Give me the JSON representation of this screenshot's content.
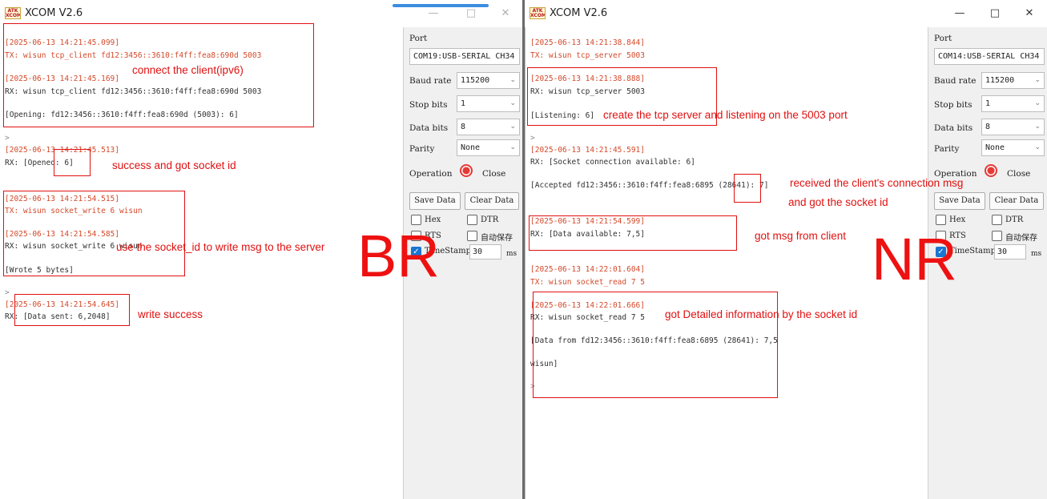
{
  "left_window": {
    "title": "XCOM V2.6",
    "logo_text": "ATK XCOM",
    "controls": {
      "minimize": "—",
      "maximize": "□",
      "close": "✕"
    },
    "terminal_lines": [
      {
        "text": "[2025-06-13 14:21:45.099]",
        "kind": "ts"
      },
      {
        "text": "TX: wisun tcp_client fd12:3456::3610:f4ff:fea8:690d 5003",
        "kind": "tx"
      },
      {
        "text": "[2025-06-13 14:21:45.169]",
        "kind": "ts"
      },
      {
        "text": "RX: wisun tcp_client fd12:3456::3610:f4ff:fea8:690d 5003",
        "kind": "rx"
      },
      {
        "text": "[Opening: fd12:3456::3610:f4ff:fea8:690d (5003): 6]",
        "kind": "rx"
      },
      {
        "text": ">",
        "kind": "gray"
      },
      {
        "text": "[2025-06-13 14:21:45.513]",
        "kind": "ts"
      },
      {
        "text": "RX: [Opened: 6]",
        "kind": "rx"
      },
      {
        "text": "[2025-06-13 14:21:54.515]",
        "kind": "ts"
      },
      {
        "text": "TX: wisun socket_write 6 wisun",
        "kind": "tx"
      },
      {
        "text": "[2025-06-13 14:21:54.585]",
        "kind": "ts"
      },
      {
        "text": "RX: wisun socket_write 6 wisun",
        "kind": "rx"
      },
      {
        "text": "[Wrote 5 bytes]",
        "kind": "rx"
      },
      {
        "text": ">",
        "kind": "gray"
      },
      {
        "text": "[2025-06-13 14:21:54.645]",
        "kind": "ts"
      },
      {
        "text": "RX: [Data sent: 6,2048]",
        "kind": "rx"
      }
    ],
    "annotations": {
      "connect": "connect the client(ipv6)",
      "success": "success and got socket id",
      "use_socket": "use the socket_id to write msg to the server",
      "write_success": "write success",
      "big_label": "BR"
    },
    "panel": {
      "port_label": "Port",
      "port_value": "COM19:USB-SERIAL CH34",
      "baud_label": "Baud rate",
      "baud_value": "115200",
      "stop_label": "Stop bits",
      "stop_value": "1",
      "data_label": "Data bits",
      "data_value": "8",
      "parity_label": "Parity",
      "parity_value": "None",
      "operation_label": "Operation",
      "close_label": "Close",
      "save_label": "Save Data",
      "clear_label": "Clear Data",
      "hex_label": "Hex",
      "dtr_label": "DTR",
      "rts_label": "RTS",
      "autosave_label": "自动保存",
      "timestamp_label": "TimeStamp",
      "timestamp_value": "30",
      "ms_label": "ms"
    }
  },
  "right_window": {
    "title": "XCOM V2.6",
    "logo_text": "ATK XCOM",
    "controls": {
      "minimize": "—",
      "maximize": "□",
      "close": "✕"
    },
    "terminal_lines": [
      {
        "text": "[2025-06-13 14:21:38.844]",
        "kind": "ts"
      },
      {
        "text": "TX: wisun tcp_server 5003",
        "kind": "tx"
      },
      {
        "text": "[2025-06-13 14:21:38.888]",
        "kind": "ts"
      },
      {
        "text": "RX: wisun tcp_server 5003",
        "kind": "rx"
      },
      {
        "text": "[Listening: 6]",
        "kind": "rx"
      },
      {
        "text": ">",
        "kind": "gray"
      },
      {
        "text": "[2025-06-13 14:21:45.591]",
        "kind": "ts"
      },
      {
        "text": "RX: [Socket connection available: 6]",
        "kind": "rx"
      },
      {
        "text": "[Accepted fd12:3456::3610:f4ff:fea8:6895 (28641): 7]",
        "kind": "rx"
      },
      {
        "text": "[2025-06-13 14:21:54.599]",
        "kind": "ts"
      },
      {
        "text": "RX: [Data available: 7,5]",
        "kind": "rx"
      },
      {
        "text": "[2025-06-13 14:22:01.604]",
        "kind": "ts"
      },
      {
        "text": "TX: wisun socket_read 7 5",
        "kind": "tx"
      },
      {
        "text": "[2025-06-13 14:22:01.666]",
        "kind": "ts"
      },
      {
        "text": "RX: wisun socket_read 7 5",
        "kind": "rx"
      },
      {
        "text": "[Data from fd12:3456::3610:f4ff:fea8:6895 (28641): 7,5",
        "kind": "rx"
      },
      {
        "text": "wisun]",
        "kind": "rx"
      },
      {
        "text": ">",
        "kind": "gray"
      }
    ],
    "annotations": {
      "create_server": "create the tcp server and listening on the 5003 port",
      "received_line1": "received the client's connection msg",
      "received_line2": "and got the socket id",
      "got_msg": "got msg from client",
      "detailed": "got Detailed information by the socket id",
      "big_label": "NR"
    },
    "panel": {
      "port_label": "Port",
      "port_value": "COM14:USB-SERIAL CH34",
      "baud_label": "Baud rate",
      "baud_value": "115200",
      "stop_label": "Stop bits",
      "stop_value": "1",
      "data_label": "Data bits",
      "data_value": "8",
      "parity_label": "Parity",
      "parity_value": "None",
      "operation_label": "Operation",
      "close_label": "Close",
      "save_label": "Save Data",
      "clear_label": "Clear Data",
      "hex_label": "Hex",
      "dtr_label": "DTR",
      "rts_label": "RTS",
      "autosave_label": "自动保存",
      "timestamp_label": "TimeStamp",
      "timestamp_value": "30",
      "ms_label": "ms"
    },
    "colors": {
      "annotation": "#e01010",
      "timestamp": "#d4492a",
      "accent": "#1976d2"
    }
  }
}
